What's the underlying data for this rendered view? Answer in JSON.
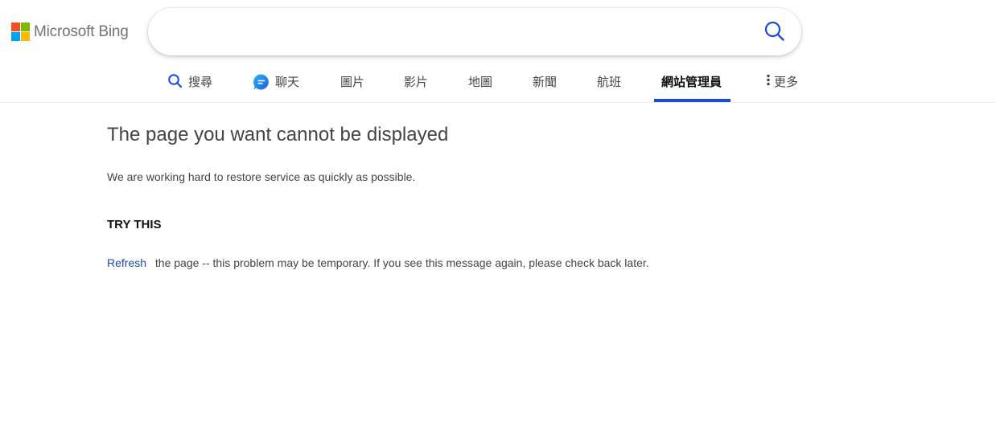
{
  "header": {
    "logo_text": "Microsoft Bing",
    "logo_colors": [
      "#f25022",
      "#7fba00",
      "#00a4ef",
      "#ffb900"
    ],
    "search": {
      "value": "",
      "placeholder": ""
    },
    "search_icon": "search-icon"
  },
  "nav": {
    "items": [
      {
        "label": "搜尋",
        "icon": "search-icon"
      },
      {
        "label": "聊天",
        "icon": "chat-bubble-icon"
      },
      {
        "label": "圖片"
      },
      {
        "label": "影片"
      },
      {
        "label": "地圖"
      },
      {
        "label": "新聞"
      },
      {
        "label": "航班"
      },
      {
        "label": "網站管理員",
        "active": true
      },
      {
        "label": "更多",
        "icon": "more-vertical-icon"
      }
    ],
    "active_color": "#174ae4"
  },
  "content": {
    "title": "The page you want cannot be displayed",
    "message": "We are working hard to restore service as quickly as possible.",
    "try_heading": "TRY THIS",
    "refresh_label": "Refresh",
    "refresh_text": "the page -- this problem may be temporary. If you see this message again, please check back later.",
    "link_color": "#1b4aaf"
  }
}
